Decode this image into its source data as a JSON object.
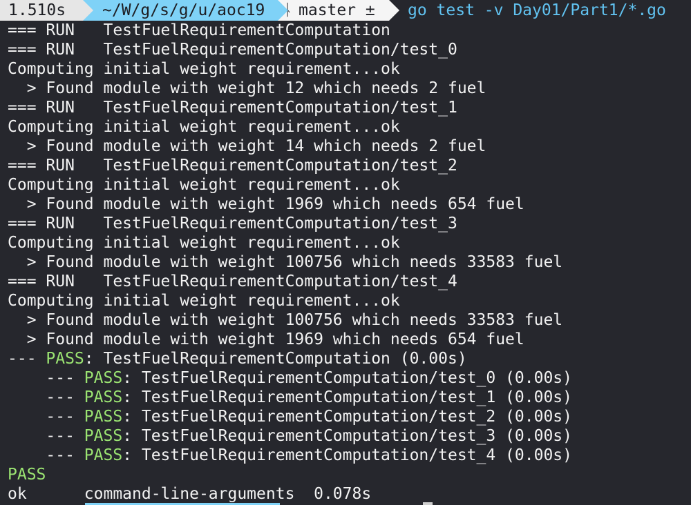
{
  "prompt": {
    "duration": "1.510s",
    "path": "~/W/g/s/g/u/aoc19",
    "branch_icon": "ᚿ",
    "branch": "master ±",
    "command": "go test -v Day01/Part1/*.go"
  },
  "output": {
    "l01": "=== RUN   TestFuelRequirementComputation",
    "l02": "=== RUN   TestFuelRequirementComputation/test_0",
    "l03": "Computing initial weight requirement...ok",
    "l04": "  > Found module with weight 12 which needs 2 fuel",
    "l05": "=== RUN   TestFuelRequirementComputation/test_1",
    "l06": "Computing initial weight requirement...ok",
    "l07": "  > Found module with weight 14 which needs 2 fuel",
    "l08": "=== RUN   TestFuelRequirementComputation/test_2",
    "l09": "Computing initial weight requirement...ok",
    "l10": "  > Found module with weight 1969 which needs 654 fuel",
    "l11": "=== RUN   TestFuelRequirementComputation/test_3",
    "l12": "Computing initial weight requirement...ok",
    "l13": "  > Found module with weight 100756 which needs 33583 fuel",
    "l14": "=== RUN   TestFuelRequirementComputation/test_4",
    "l15": "Computing initial weight requirement...ok",
    "l16": "  > Found module with weight 100756 which needs 33583 fuel",
    "l17": "  > Found module with weight 1969 which needs 654 fuel",
    "summary": {
      "dash_top": "--- ",
      "dash_sub": "    --- ",
      "pass_word": "PASS",
      "top_rest": ": TestFuelRequirementComputation (0.00s)",
      "sub0_rest": ": TestFuelRequirementComputation/test_0 (0.00s)",
      "sub1_rest": ": TestFuelRequirementComputation/test_1 (0.00s)",
      "sub2_rest": ": TestFuelRequirementComputation/test_2 (0.00s)",
      "sub3_rest": ": TestFuelRequirementComputation/test_3 (0.00s)",
      "sub4_rest": ": TestFuelRequirementComputation/test_4 (0.00s)"
    },
    "final_pass": "PASS",
    "ok_line": "ok      command-line-arguments  0.078s"
  },
  "colors": {
    "background": "#26272d",
    "pass_green": "#9be472",
    "command_blue": "#61c2f0",
    "path_segment": "#7fd2f7"
  }
}
